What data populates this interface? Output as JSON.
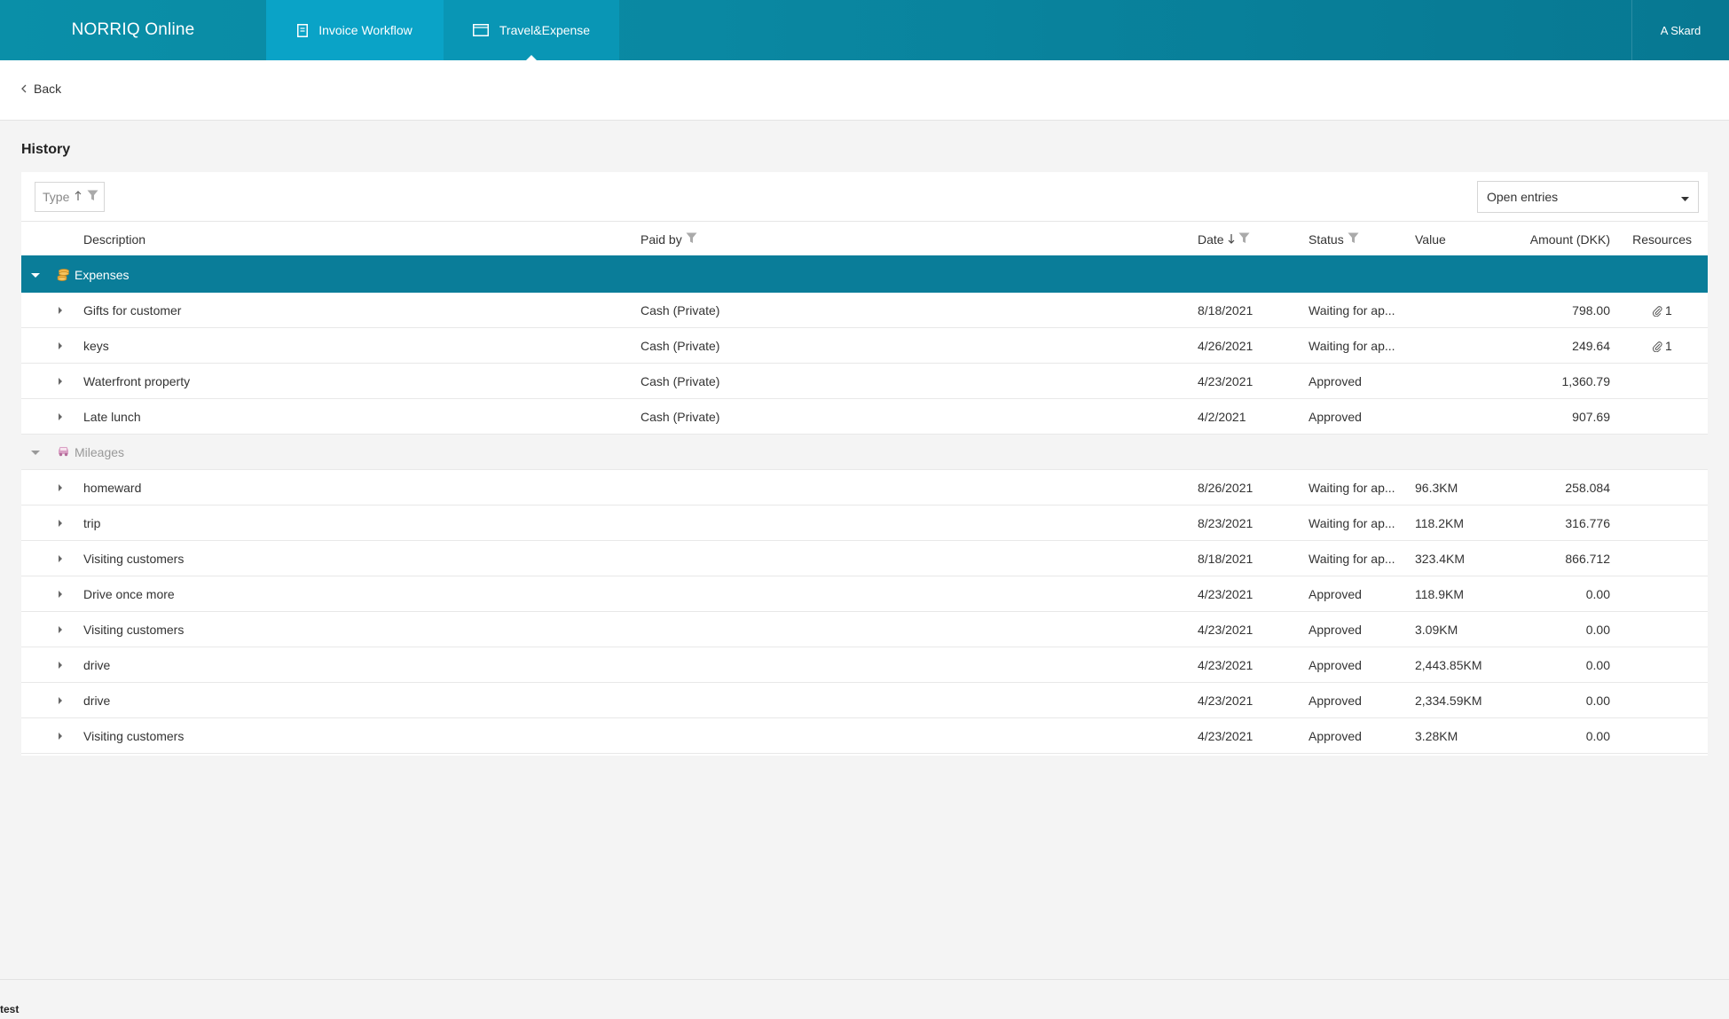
{
  "header": {
    "brand": "NORRIQ Online",
    "tabs": [
      {
        "label": "Invoice Workflow",
        "icon": "document-icon"
      },
      {
        "label": "Travel&Expense",
        "icon": "wallet-icon"
      }
    ],
    "user": "A Skard"
  },
  "nav": {
    "back_label": "Back"
  },
  "page": {
    "title": "History"
  },
  "toolbar": {
    "type_filter_label": "Type",
    "entries_select_value": "Open entries"
  },
  "columns": {
    "description": "Description",
    "paid_by": "Paid by",
    "date": "Date",
    "status": "Status",
    "value": "Value",
    "amount": "Amount (DKK)",
    "resources": "Resources"
  },
  "groups": {
    "expenses": {
      "label": "Expenses",
      "rows": [
        {
          "description": "Gifts for customer",
          "paid_by": "Cash (Private)",
          "date": "8/18/2021",
          "status": "Waiting for ap...",
          "value": "",
          "amount": "798.00",
          "resources": "1"
        },
        {
          "description": "keys",
          "paid_by": "Cash (Private)",
          "date": "4/26/2021",
          "status": "Waiting for ap...",
          "value": "",
          "amount": "249.64",
          "resources": "1"
        },
        {
          "description": "Waterfront property",
          "paid_by": "Cash (Private)",
          "date": "4/23/2021",
          "status": "Approved",
          "value": "",
          "amount": "1,360.79",
          "resources": ""
        },
        {
          "description": "Late lunch",
          "paid_by": "Cash (Private)",
          "date": "4/2/2021",
          "status": "Approved",
          "value": "",
          "amount": "907.69",
          "resources": ""
        }
      ]
    },
    "mileages": {
      "label": "Mileages",
      "rows": [
        {
          "description": "homeward",
          "paid_by": "",
          "date": "8/26/2021",
          "status": "Waiting for ap...",
          "value": "96.3KM",
          "amount": "258.084",
          "resources": ""
        },
        {
          "description": "trip",
          "paid_by": "",
          "date": "8/23/2021",
          "status": "Waiting for ap...",
          "value": "118.2KM",
          "amount": "316.776",
          "resources": ""
        },
        {
          "description": "Visiting customers",
          "paid_by": "",
          "date": "8/18/2021",
          "status": "Waiting for ap...",
          "value": "323.4KM",
          "amount": "866.712",
          "resources": ""
        },
        {
          "description": "Drive once more",
          "paid_by": "",
          "date": "4/23/2021",
          "status": "Approved",
          "value": "118.9KM",
          "amount": "0.00",
          "resources": ""
        },
        {
          "description": "Visiting customers",
          "paid_by": "",
          "date": "4/23/2021",
          "status": "Approved",
          "value": "3.09KM",
          "amount": "0.00",
          "resources": ""
        },
        {
          "description": "drive",
          "paid_by": "",
          "date": "4/23/2021",
          "status": "Approved",
          "value": "2,443.85KM",
          "amount": "0.00",
          "resources": ""
        },
        {
          "description": "drive",
          "paid_by": "",
          "date": "4/23/2021",
          "status": "Approved",
          "value": "2,334.59KM",
          "amount": "0.00",
          "resources": ""
        },
        {
          "description": "Visiting customers",
          "paid_by": "",
          "date": "4/23/2021",
          "status": "Approved",
          "value": "3.28KM",
          "amount": "0.00",
          "resources": ""
        }
      ]
    }
  },
  "footer": {
    "text": "test"
  },
  "colors": {
    "accent": "#0a7d99",
    "topbar": "#0a8fa8",
    "active_tab": "#0aa3c7"
  }
}
